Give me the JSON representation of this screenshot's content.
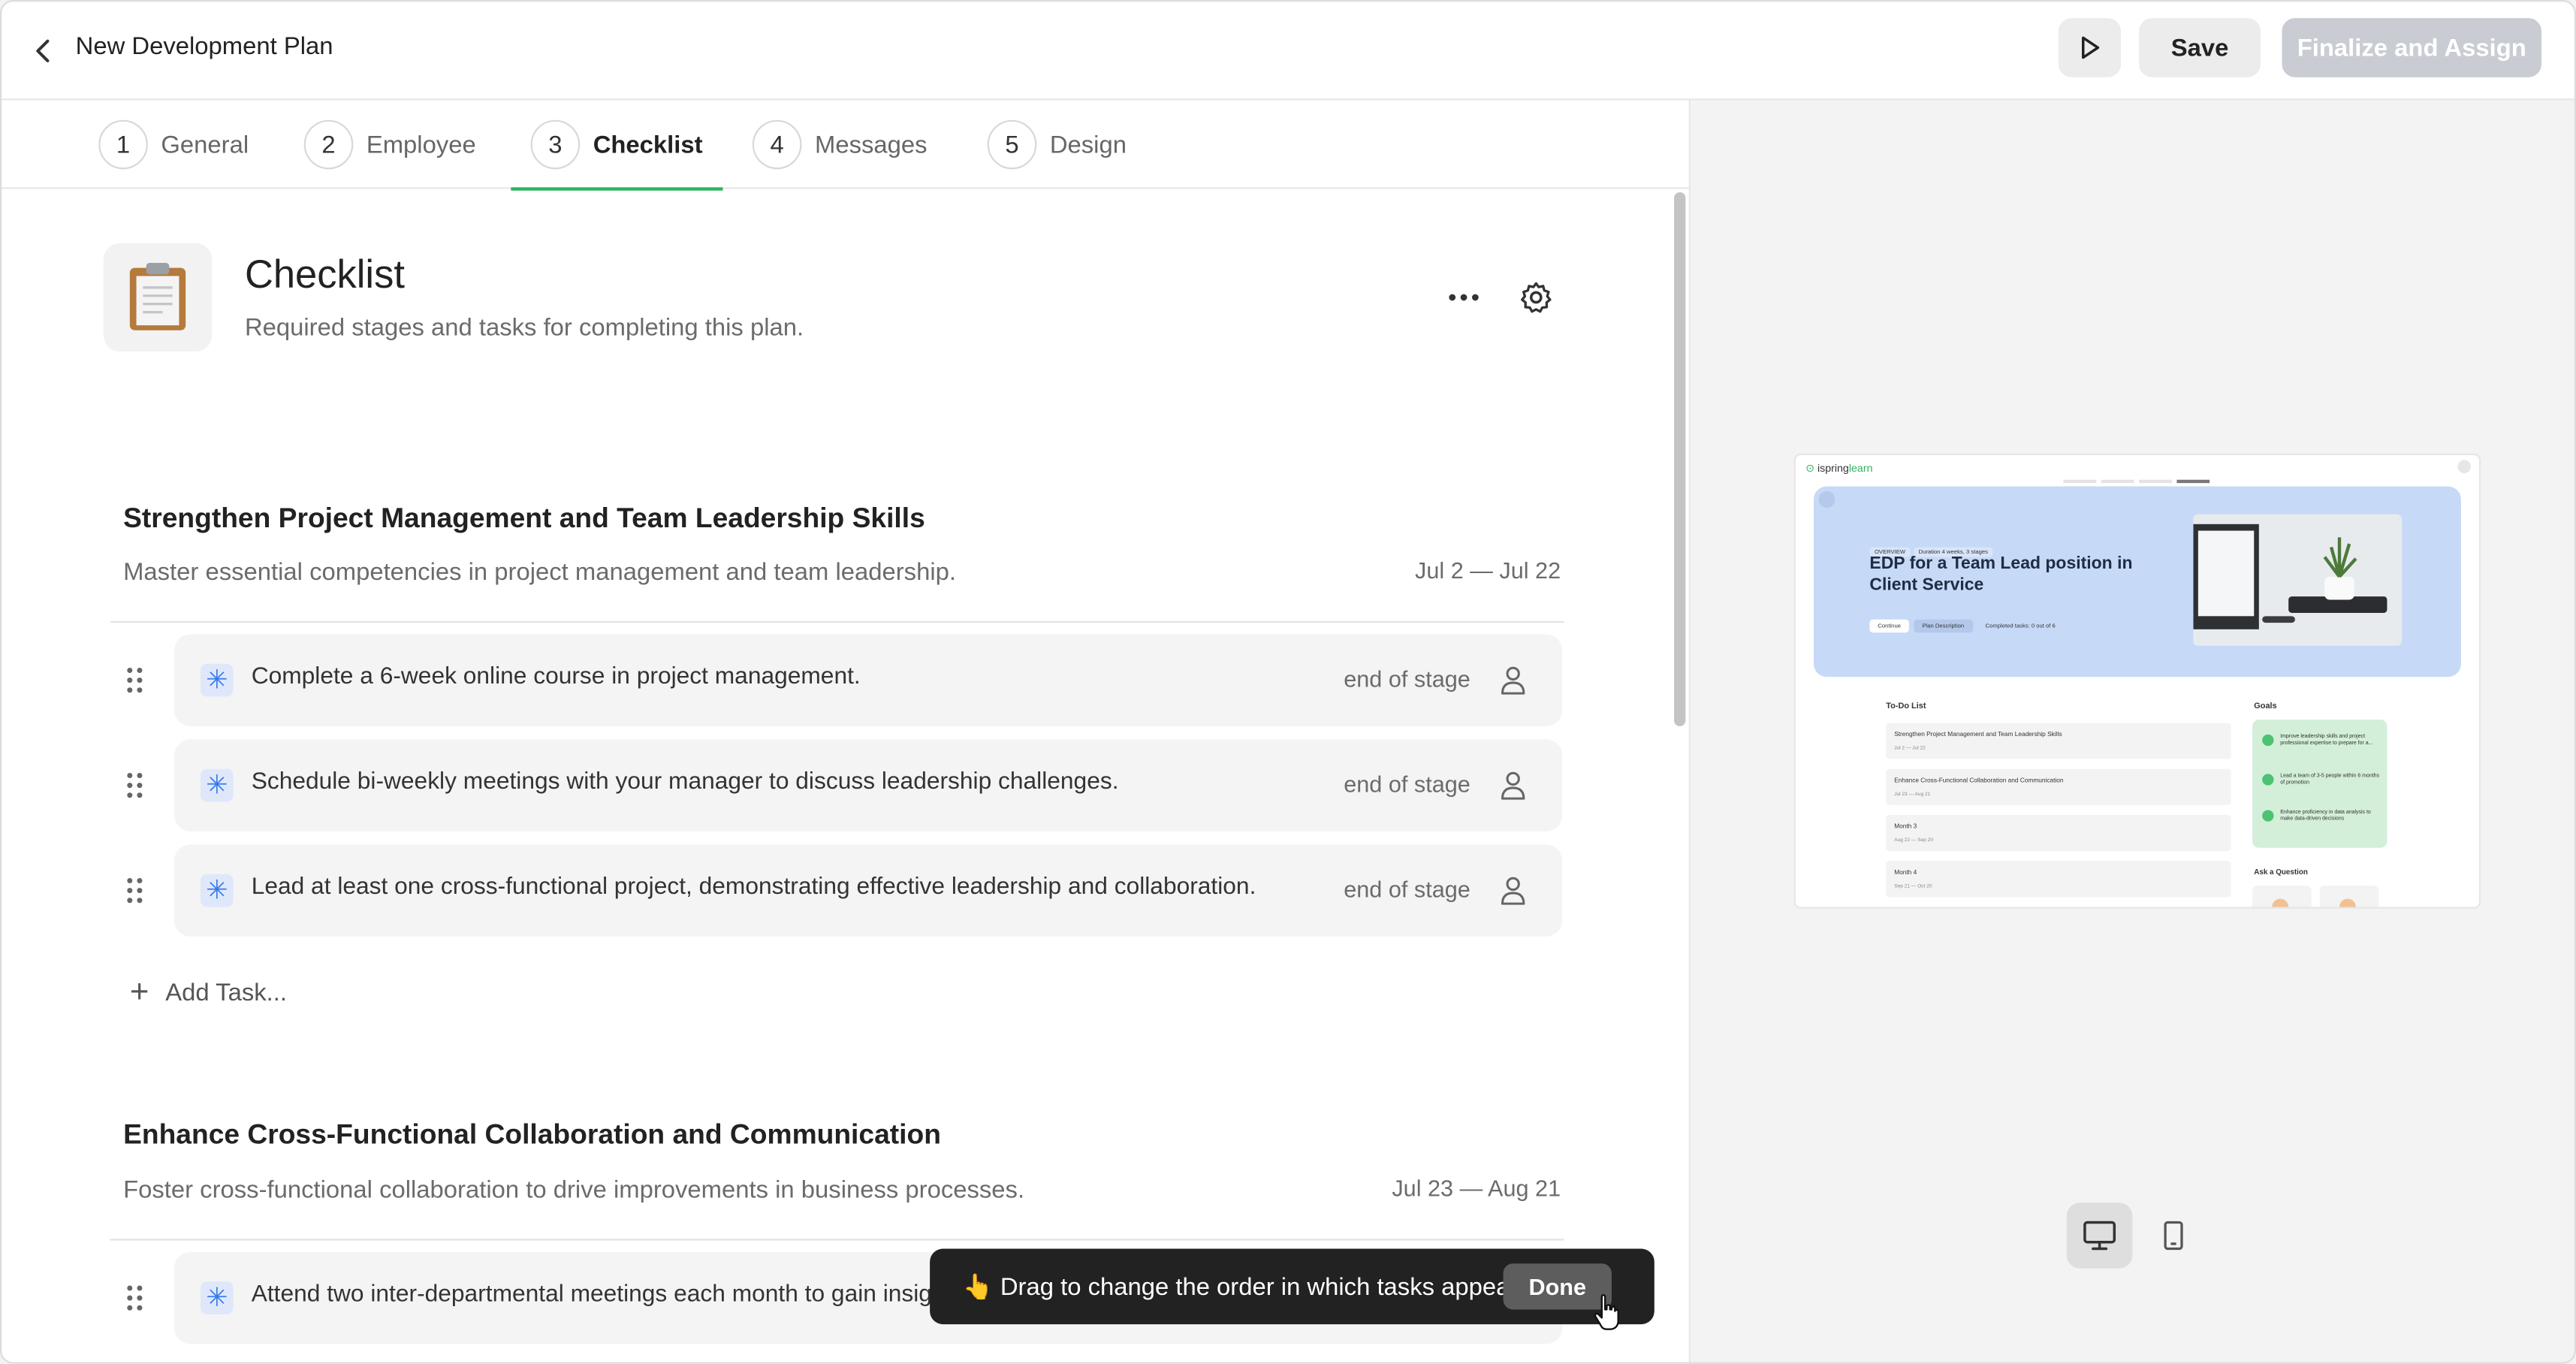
{
  "topbar": {
    "title": "New Development Plan",
    "save_label": "Save",
    "finalize_label": "Finalize and Assign"
  },
  "tabs": [
    {
      "num": "1",
      "label": "General"
    },
    {
      "num": "2",
      "label": "Employee"
    },
    {
      "num": "3",
      "label": "Checklist"
    },
    {
      "num": "4",
      "label": "Messages"
    },
    {
      "num": "5",
      "label": "Design"
    }
  ],
  "active_tab": "Checklist",
  "header": {
    "title": "Checklist",
    "subtitle": "Required stages and tasks for completing this plan."
  },
  "stages": [
    {
      "title": "Strengthen Project Management and Team Leadership Skills",
      "description": "Master essential competencies in project management and team leadership.",
      "dates": "Jul 2 — Jul 22",
      "tasks": [
        {
          "text": "Complete a 6-week online course in project management.",
          "due": "end of stage"
        },
        {
          "text": "Schedule bi-weekly meetings with your manager to discuss leadership challenges.",
          "due": "end of stage"
        },
        {
          "text": "Lead at least one cross-functional project, demonstrating effective leadership and collaboration.",
          "due": "end of stage"
        }
      ],
      "add_task_label": "Add Task..."
    },
    {
      "title": "Enhance Cross-Functional Collaboration and Communication",
      "description": "Foster cross-functional collaboration to drive improvements in business processes.",
      "dates": "Jul 23 — Aug 21",
      "tasks": [
        {
          "text": "Attend two inter-departmental meetings each month to gain insig",
          "due": ""
        }
      ]
    }
  ],
  "toast": {
    "message": "👆 Drag to change the order in which tasks appear.",
    "done_label": "Done"
  },
  "preview": {
    "logo_a": "ispring",
    "logo_b": "learn",
    "tags": [
      "OVERVIEW",
      "Duration 4 weeks, 3 stages"
    ],
    "hero_title": "EDP for a Team Lead position in Client Service",
    "hero_buttons": [
      "Continue",
      "Plan Description",
      "Completed tasks: 0 out of 6"
    ],
    "todo_title": "To-Do List",
    "todo_items": [
      {
        "title": "Strengthen Project Management and Team Leadership Skills",
        "dates": "Jul 2 — Jul 22"
      },
      {
        "title": "Enhance Cross-Functional Collaboration and Communication",
        "dates": "Jul 23 — Aug 21"
      },
      {
        "title": "Month 3",
        "dates": "Aug 22 — Sep 20"
      },
      {
        "title": "Month 4",
        "dates": "Sep 21 — Oct 20"
      }
    ],
    "goals_title": "Goals",
    "goals": [
      "Improve leadership skills and project professional expertise to prepare for a...",
      "Lead a team of 3-5 people within 6 months of promotion",
      "Enhance proficiency in data analysis to make data-driven decisions"
    ],
    "ask_title": "Ask a Question"
  },
  "icons": {
    "back": "chevron-left-icon",
    "play": "play-icon",
    "clipboard": "clipboard-icon",
    "more": "more-horizontal-icon",
    "gear": "gear-icon",
    "drag": "drag-handle-icon",
    "task": "asterisk-icon",
    "user": "user-icon",
    "plus": "plus-icon",
    "desktop": "desktop-icon",
    "mobile": "mobile-icon"
  },
  "colors": {
    "accent_green": "#2bb35e",
    "task_icon_blue": "#3a7bea",
    "finalize_disabled": "#c9ccd2",
    "toast_bg": "#222222",
    "preview_hero": "#c6d9f7",
    "preview_goals": "#d3efd9"
  }
}
